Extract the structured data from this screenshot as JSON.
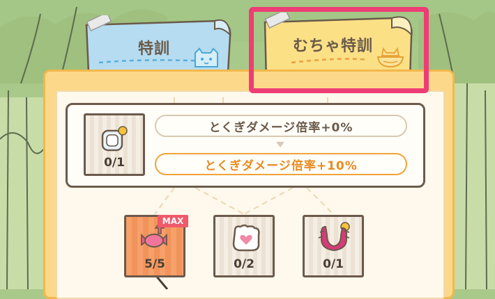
{
  "tabs": [
    {
      "label": "特訓",
      "selected": false
    },
    {
      "label": "むちゃ特訓",
      "selected": true
    }
  ],
  "skill_detail": {
    "count": "0/1",
    "current_effect": "とくぎダメージ倍率+0%",
    "next_effect": "とくぎダメージ倍率+10%"
  },
  "nodes": [
    {
      "icon": "candy-up-icon",
      "count": "5/5",
      "badge": "MAX",
      "state": "maxed"
    },
    {
      "icon": "heart-face-icon",
      "count": "0/2",
      "state": "locked"
    },
    {
      "icon": "claw-sun-icon",
      "count": "0/1",
      "state": "locked"
    }
  ],
  "colors": {
    "accent_pink": "#ee3d74",
    "tab_blue": "#b5dcf0",
    "tab_yellow": "#fbe086",
    "next_effect_orange": "#ea8a1e",
    "panel_yellow": "#fcd98a"
  }
}
